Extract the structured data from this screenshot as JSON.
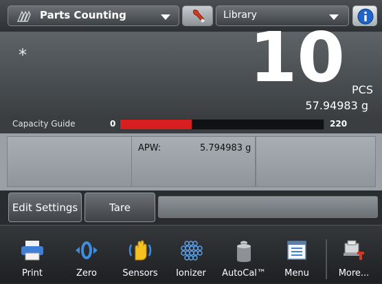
{
  "header": {
    "mode_label": "Parts Counting",
    "library_label": "Library"
  },
  "display": {
    "stability_indicator": "*",
    "main_value": "10",
    "main_unit": "PCS",
    "secondary_value": "57.94983 g"
  },
  "capacity_guide": {
    "label": "Capacity Guide",
    "min": "0",
    "max": "220",
    "fill_fraction": 0.35,
    "fill_color": "#d81e1e"
  },
  "info": {
    "apw_label": "APW:",
    "apw_value": "5.794983 g"
  },
  "actions": {
    "edit_settings": "Edit Settings",
    "tare": "Tare"
  },
  "toolbar": [
    {
      "label": "Print",
      "icon": "printer-icon"
    },
    {
      "label": "Zero",
      "icon": "zero-icon"
    },
    {
      "label": "Sensors",
      "icon": "hand-sensor-icon"
    },
    {
      "label": "Ionizer",
      "icon": "ionizer-icon"
    },
    {
      "label": "AutoCal™",
      "icon": "calibration-weight-icon"
    },
    {
      "label": "Menu",
      "icon": "menu-icon"
    },
    {
      "label": "More...",
      "icon": "more-icon"
    }
  ]
}
